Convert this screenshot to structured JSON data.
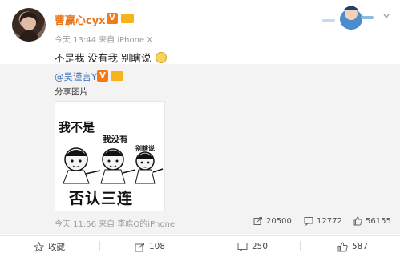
{
  "post": {
    "author": "曹赢心cyx",
    "verified_badge": "V",
    "meta": "今天 13:44 来自 iPhone X",
    "text": "不是我 没有我 别瞎说"
  },
  "repost": {
    "author": "@吴谨言Y",
    "verified_badge": "V",
    "text": "分享图片",
    "meme": {
      "line1": "我不是",
      "line2": "我没有",
      "line3": "别瞎说",
      "caption": "否认三连"
    },
    "meta": "今天 11:56 来自 李皓O的iPhone",
    "stats": {
      "reposts": "20500",
      "comments": "12772",
      "likes": "56155"
    }
  },
  "actions": {
    "favorite": "收藏",
    "repost_count": "108",
    "comment_count": "250",
    "like_count": "587"
  },
  "colors": {
    "username": "#e8751a",
    "mention_link": "#3b6fb3",
    "verified_badge": "#f37a16",
    "repost_background": "#f3f3f3"
  }
}
